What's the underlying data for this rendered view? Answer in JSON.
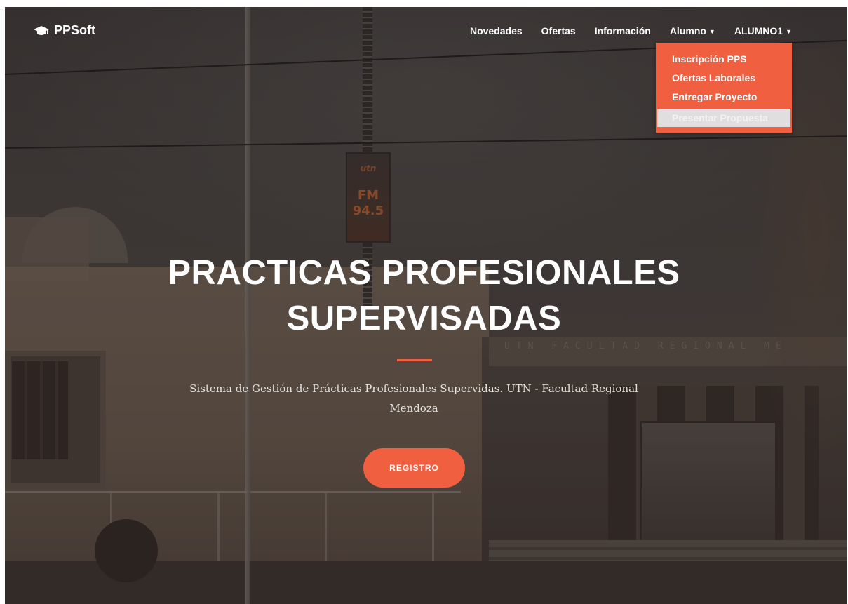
{
  "navbar": {
    "brand": "PPSoft",
    "brand_icon": "graduation-cap-icon",
    "links": {
      "novedades": "Novedades",
      "ofertas": "Ofertas",
      "informacion": "Información",
      "alumno": "Alumno",
      "user": "ALUMNO1"
    },
    "caret_icon": "caret-down-icon"
  },
  "dropdown": {
    "open_menu": "Alumno",
    "items": [
      "Inscripción PPS",
      "Ofertas Laborales",
      "Entregar Proyecto",
      "Presentar Propuesta"
    ],
    "highlighted_item": "Presentar Propuesta"
  },
  "background": {
    "sign_top": "utn",
    "sign_fm": "FM",
    "sign_freq": "94.5",
    "facade_text": "UTN FACULTAD REGIONAL ME"
  },
  "hero": {
    "title_line1": "PRACTICAS PROFESIONALES",
    "title_line2": "SUPERVISADAS",
    "subtitle": "Sistema de Gestión de Prácticas Profesionales Supervidas. UTN - Facultad Regional Mendoza",
    "button_label": "REGISTRO"
  },
  "colors": {
    "accent": "#f05f40",
    "text": "#ffffff",
    "dropdown_highlight": "#e0dede"
  }
}
